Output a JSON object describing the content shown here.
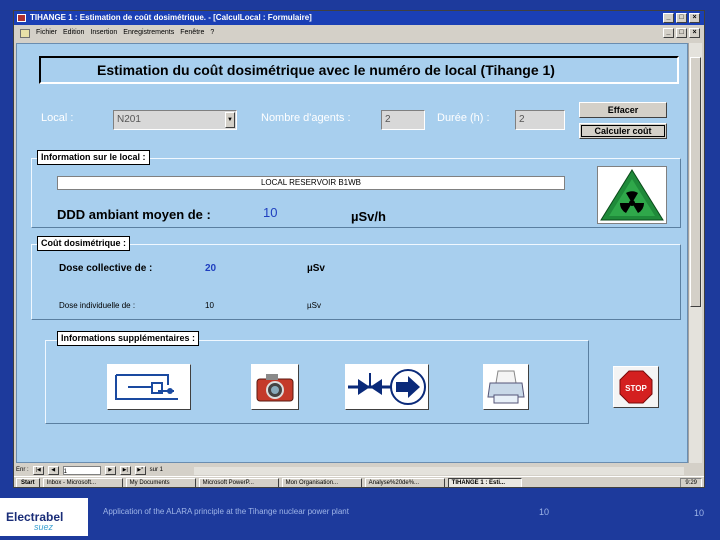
{
  "window": {
    "title": "TIHANGE 1 : Estimation de coût dosimétrique. - [CalculLocal : Formulaire]",
    "controls": {
      "minimize": "_",
      "maximize": "□",
      "close": "×"
    }
  },
  "menu": {
    "items": [
      "Fichier",
      "Edition",
      "Insertion",
      "Enregistrements",
      "Fenêtre",
      "?"
    ]
  },
  "form": {
    "header": "Estimation du coût dosimétrique avec le numéro de local  (Tihange 1)",
    "local_label": "Local :",
    "local_value": "N201",
    "agents_label": "Nombre d'agents :",
    "agents_value": "2",
    "duree_label": "Durée (h) :",
    "duree_value": "2",
    "btn_effacer": "Effacer",
    "btn_calculer": "Calculer coût",
    "info_local_title": "Information sur le local :",
    "local_name": "LOCAL RESERVOIR B1WB",
    "ddd_label": "DDD ambiant moyen de :",
    "ddd_value": "10",
    "ddd_unit": "µSv/h",
    "cout_title": "Coût dosimétrique :",
    "dose_coll_label": "Dose collective de :",
    "dose_coll_value": "20",
    "dose_coll_unit": "µSv",
    "dose_ind_label": "Dose individuelle de :",
    "dose_ind_value": "10",
    "dose_ind_unit": "µSv",
    "info_supp_title": "Informations supplémentaires :"
  },
  "icons": {
    "radiation": "radiation-warning-icon",
    "schema": "schematic-icon",
    "camera": "camera-icon",
    "valve": "valve-flow-icon",
    "printer": "printer-icon",
    "stop": "stop-icon"
  },
  "stop_label": "STOP",
  "record_nav": {
    "label": "Enr :",
    "position": "1",
    "total": "sur 1"
  },
  "taskbar": {
    "start": "Start",
    "tasks": [
      "Inbox - Microsoft...",
      "My Documents",
      "Microsoft PowerP...",
      "Mon Organisation...",
      "Analyse%20de%...",
      "TIHANGE 1 : Esti..."
    ],
    "clock": "9:29"
  },
  "footer": {
    "logo": "Electrabel",
    "logo_sub": "suez",
    "caption": "Application of the ALARA principle at the Tihange nuclear power plant",
    "num1": "10",
    "num2": "10"
  },
  "colors": {
    "slide_bg": "#1d3a9c",
    "form_bg": "#a8cfee",
    "value_blue": "#1f3fbf",
    "radiation_green": "#1f8a3a"
  }
}
